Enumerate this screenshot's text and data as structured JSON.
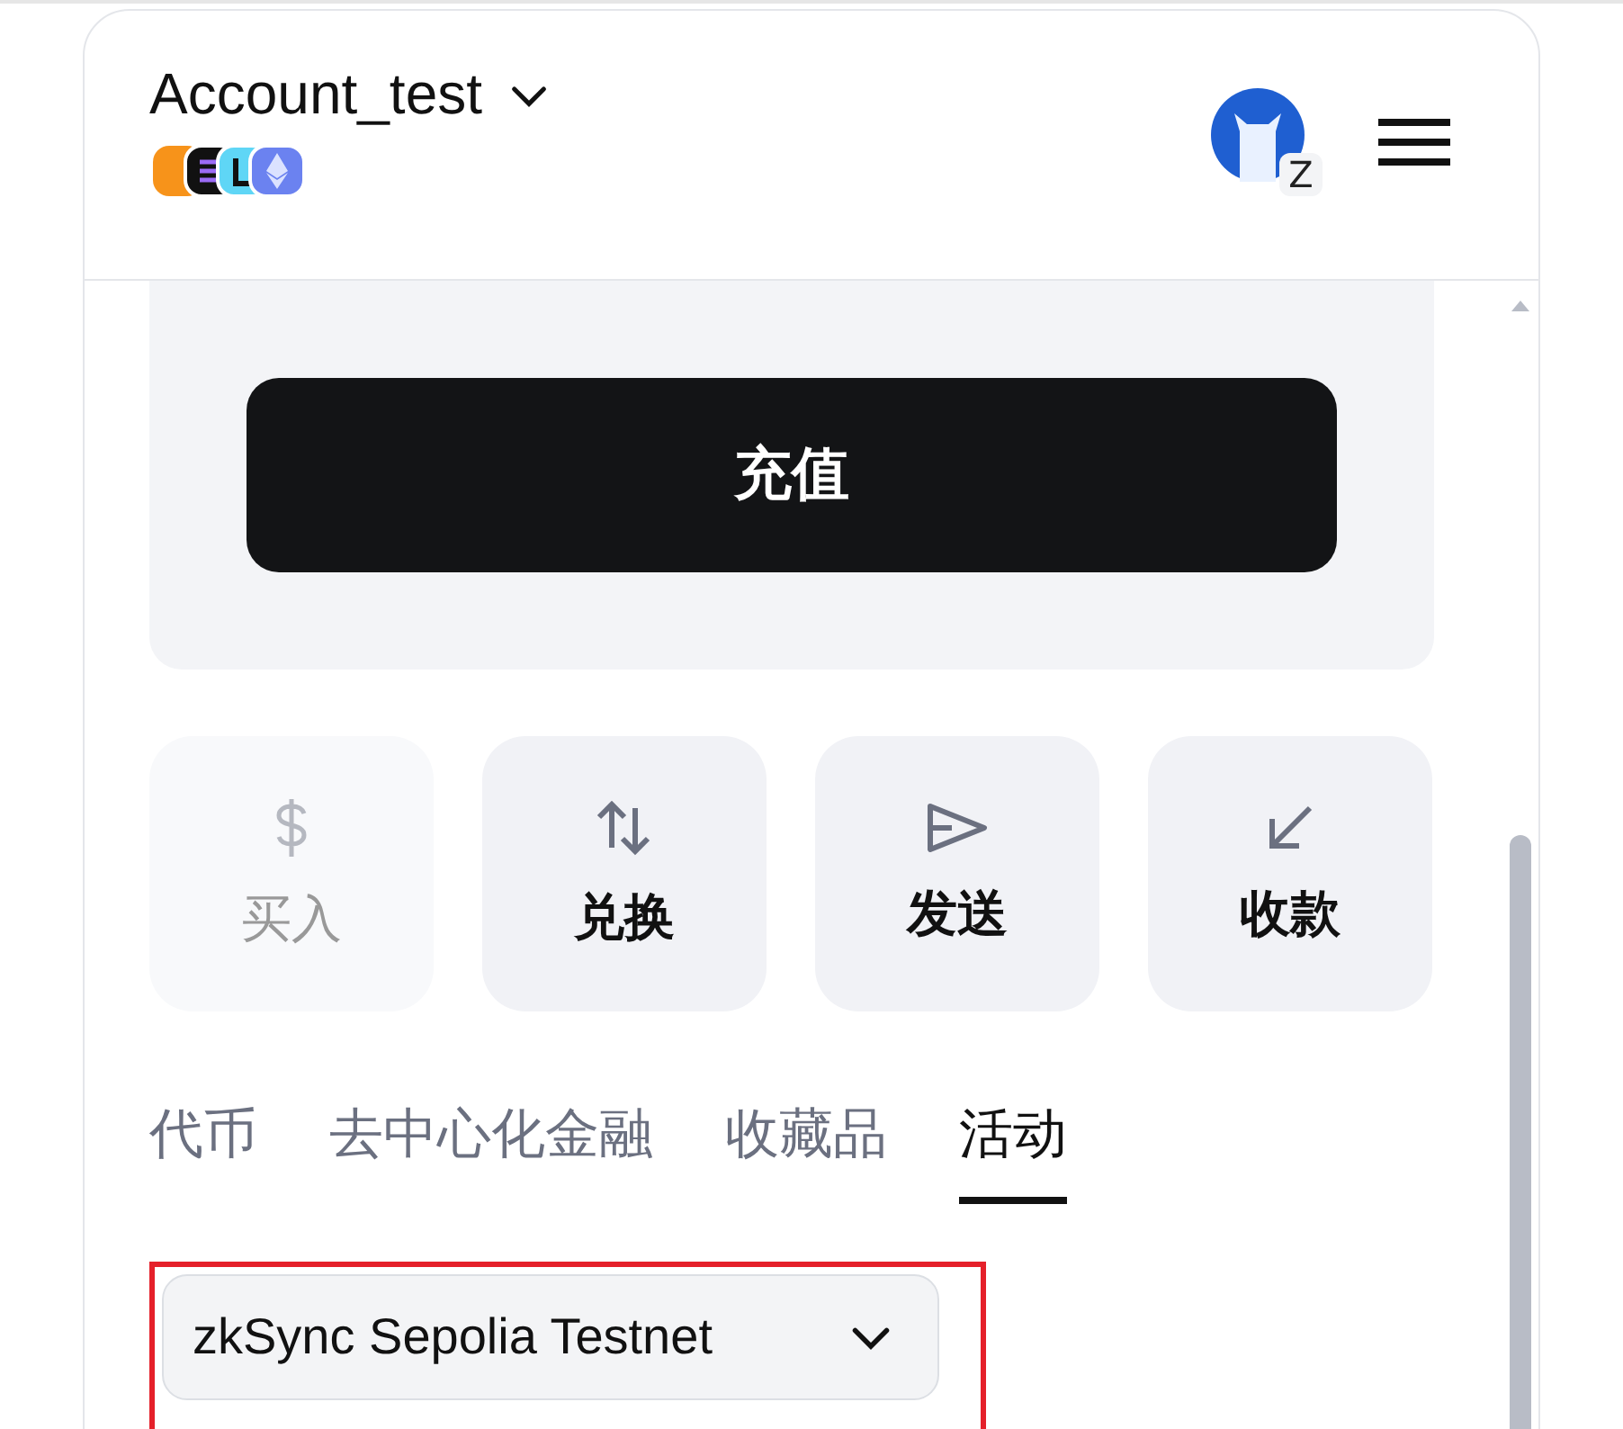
{
  "header": {
    "account_name": "Account_test",
    "avatar_badge": "Z"
  },
  "deposit_button": "充值",
  "actions": [
    {
      "label": "买入",
      "kind": "buy",
      "disabled": true
    },
    {
      "label": "兑换",
      "kind": "swap",
      "disabled": false
    },
    {
      "label": "发送",
      "kind": "send",
      "disabled": false
    },
    {
      "label": "收款",
      "kind": "receive",
      "disabled": false
    }
  ],
  "tabs": [
    {
      "label": "代币",
      "selected": false
    },
    {
      "label": "去中心化金融",
      "selected": false
    },
    {
      "label": "收藏品",
      "selected": false
    },
    {
      "label": "活动",
      "selected": true
    }
  ],
  "network_dropdown": {
    "value": "zkSync Sepolia Testnet",
    "highlighted": true
  }
}
